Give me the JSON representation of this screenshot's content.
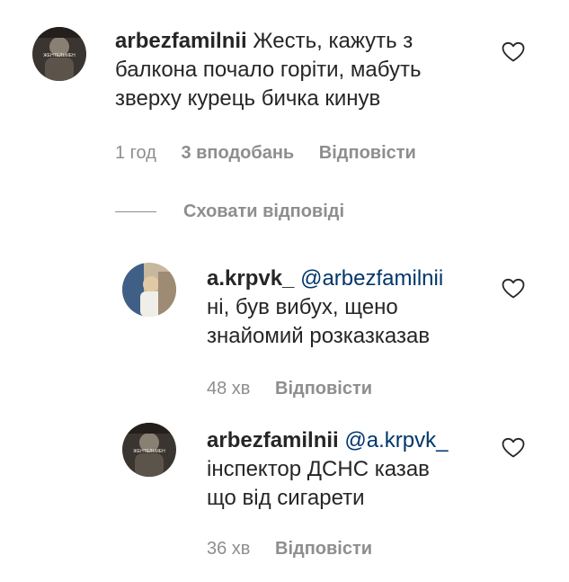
{
  "comment": {
    "username": "arbezfamilnii",
    "text": "Жесть, кажуть з балкона почало горіти, мабуть зверху курець бичка кинув",
    "time": "1 год",
    "likes": "3 вподобань",
    "reply_label": "Відповісти",
    "avatar_text": "ЖЕНТЕЛЬМЕН"
  },
  "hide_replies_label": "Сховати відповіді",
  "replies": [
    {
      "username": "a.krpvk_",
      "mention": "@arbezfamilnii",
      "text_line1": "ні, був вибух, щено",
      "text_line2": "знайомий розказказав",
      "time": "48 хв",
      "reply_label": "Відповісти"
    },
    {
      "username": "arbezfamilnii",
      "mention": "@a.krpvk_",
      "text_line1": "інспектор ДСНС казав",
      "text_line2": "що від сигарети",
      "time": "36 хв",
      "reply_label": "Відповісти",
      "avatar_text": "ЖЕНТЕЛЬМЕН"
    }
  ],
  "icons": {
    "like": "heart-icon"
  },
  "colors": {
    "text": "#262626",
    "secondary": "#8e8e8e",
    "mention": "#00376b"
  }
}
